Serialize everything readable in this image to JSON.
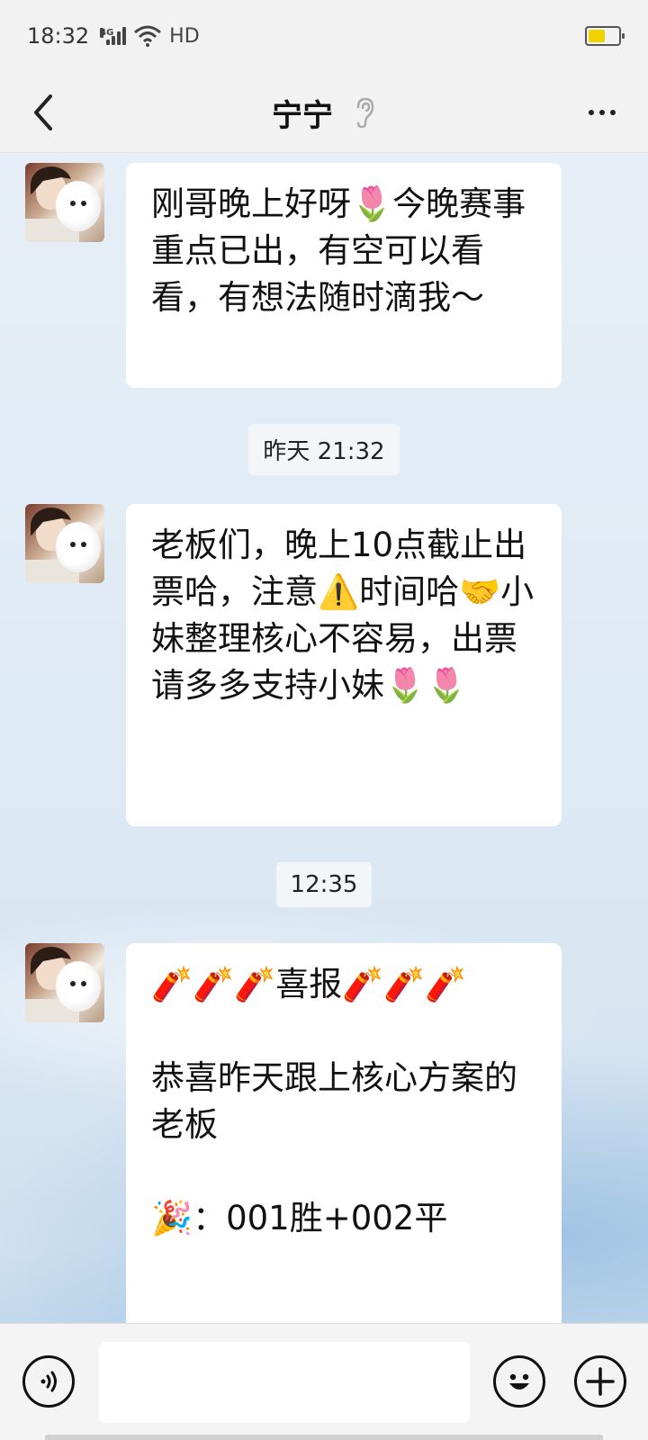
{
  "status_bar": {
    "time": "18:32",
    "network": "4G",
    "hd_label": "HD",
    "battery_level": 0.5,
    "battery_color": "#f2d300"
  },
  "header": {
    "back_icon": "chevron-left-icon",
    "title": "宁宁",
    "ear_icon": "ear-icon",
    "more_icon": "more-dots-icon"
  },
  "messages": [
    {
      "sender_avatar": "avatar-girl-with-dog",
      "text": "刚哥晚上好呀🌷今晚赛事重点已出，有空可以看看，有想法随时滴我～"
    },
    {
      "timestamp": "昨天 21:32"
    },
    {
      "sender_avatar": "avatar-girl-with-dog",
      "text": "老板们，晚上10点截止出票哈，注意⚠️时间哈🤝小妹整理核心不容易，出票请多多支持小妹🌷🌷"
    },
    {
      "timestamp": "12:35"
    },
    {
      "sender_avatar": "avatar-girl-with-dog",
      "text": "🧨🧨🧨喜报🧨🧨🧨\n\n恭喜昨天跟上核心方案的老板\n\n🎉：001胜+002平"
    }
  ],
  "input_bar": {
    "voice_icon": "voice-icon",
    "input_value": "",
    "emoji_icon": "smiley-icon",
    "plus_icon": "plus-icon"
  },
  "colors": {
    "bubble_bg": "#ffffff",
    "header_bg": "#f2f2f2",
    "chat_bg": "#e6eff7"
  }
}
